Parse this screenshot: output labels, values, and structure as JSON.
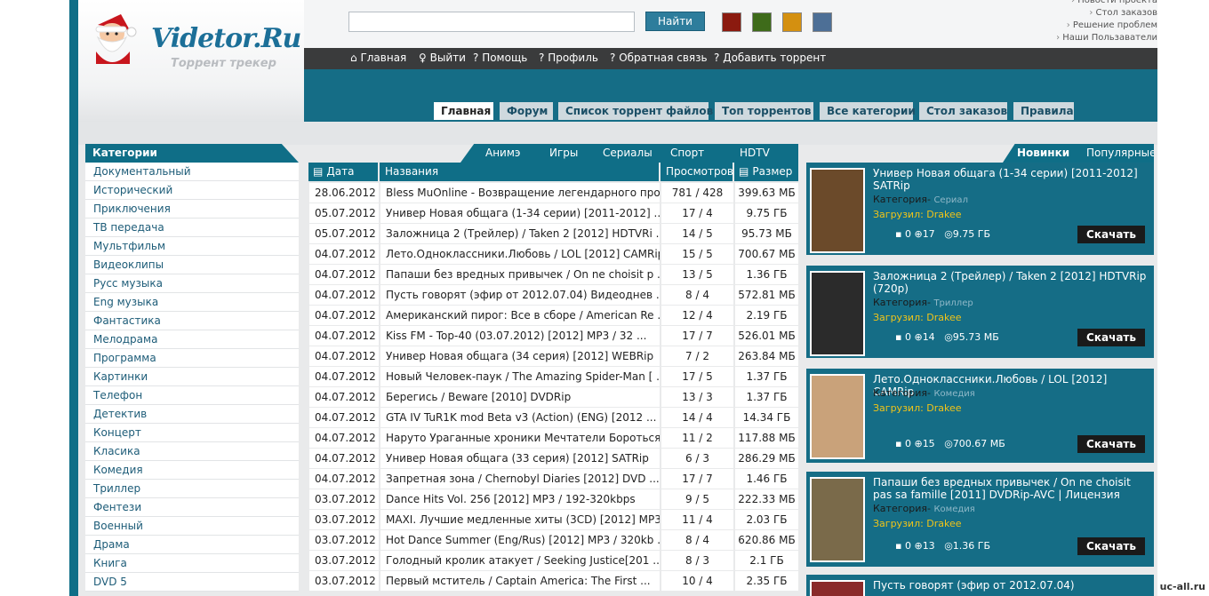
{
  "logo": {
    "title": "Videtor.Ru",
    "subtitle": "Торрент трекер"
  },
  "search": {
    "placeholder": "",
    "value": "",
    "button": "Найти"
  },
  "swatches": [
    "#8b1a0f",
    "#3e6b1a",
    "#d49010",
    "#4d6f96"
  ],
  "right_links": [
    "Новости проекта",
    "Стол заказов",
    "Решение проблем",
    "Наши Пользаватели"
  ],
  "nav": [
    {
      "icon": "home-icon",
      "label": "Главная"
    },
    {
      "icon": "key-icon",
      "label": "Выйти"
    },
    {
      "icon": "question-icon",
      "label": "Помощь"
    },
    {
      "icon": "question-icon",
      "label": "Профиль"
    },
    {
      "icon": "question-icon",
      "label": "Обратная связь"
    },
    {
      "icon": "question-icon",
      "label": "Добавить торрент"
    }
  ],
  "tabs": [
    "Главная",
    "Форум",
    "Список торрент файлов",
    "Топ торрентов",
    "Все категории",
    "Стол заказов",
    "Правила"
  ],
  "categories": {
    "title": "Категории",
    "items": [
      "Документальный",
      "Исторический",
      "Приключения",
      "ТВ передача",
      "Мультфильм",
      "Видеоклипы",
      "Русс музыка",
      "Eng музыка",
      "Фантастика",
      "Мелодрама",
      "Программа",
      "Картинки",
      "Телефон",
      "Детектив",
      "Концерт",
      "Класика",
      "Комедия",
      "Триллер",
      "Фентези",
      "Военный",
      "Драма",
      "Книга",
      "DVD 5"
    ]
  },
  "genres": [
    "Анимэ",
    "Игры",
    "Сериалы",
    "Спорт",
    "HDTV"
  ],
  "table": {
    "headers": {
      "date": "Дата",
      "name": "Названия",
      "views": "Просмотров",
      "size": "Размер"
    },
    "rows": [
      {
        "date": "28.06.2012",
        "name": "Bless MuOnline - Возвращение легендарного про ...",
        "views": "781 / 428",
        "size": "399.63 МБ"
      },
      {
        "date": "05.07.2012",
        "name": "Универ Новая общага (1-34 серии) [2011-2012] ...",
        "views": "17 / 4",
        "size": "9.75 ГБ"
      },
      {
        "date": "05.07.2012",
        "name": "Заложница 2 (Трейлер) / Taken 2 [2012] HDTVRi ...",
        "views": "14 / 5",
        "size": "95.73 МБ"
      },
      {
        "date": "04.07.2012",
        "name": "Лето.Одноклассники.Любовь / LOL [2012] CAMRip",
        "views": "15 / 5",
        "size": "700.67 МБ"
      },
      {
        "date": "04.07.2012",
        "name": "Папаши без вредных привычек / On ne choisit p ...",
        "views": "13 / 5",
        "size": "1.36 ГБ"
      },
      {
        "date": "04.07.2012",
        "name": "Пусть говорят (эфир от 2012.07.04) Видеоднев ...",
        "views": "8 / 4",
        "size": "572.81 МБ"
      },
      {
        "date": "04.07.2012",
        "name": "Американский пирог: Все в сборе / American Re ...",
        "views": "12 / 4",
        "size": "2.19 ГБ"
      },
      {
        "date": "04.07.2012",
        "name": "Kiss FM - Top-40 (03.07.2012) [2012] MP3 / 32 ...",
        "views": "17 / 7",
        "size": "526.01 МБ"
      },
      {
        "date": "04.07.2012",
        "name": "Универ Новая общага (34 серия) [2012] WEBRip",
        "views": "7 / 2",
        "size": "263.84 МБ"
      },
      {
        "date": "04.07.2012",
        "name": "Новый Человек-паук / The Amazing Spider-Man [ ...",
        "views": "17 / 5",
        "size": "1.37 ГБ"
      },
      {
        "date": "04.07.2012",
        "name": "Берегись / Beware [2010] DVDRip",
        "views": "13 / 3",
        "size": "1.37 ГБ"
      },
      {
        "date": "04.07.2012",
        "name": "GTA IV TuR1K mod Beta v3 (Action) (ENG) [2012 ...",
        "views": "14 / 4",
        "size": "14.34 ГБ"
      },
      {
        "date": "04.07.2012",
        "name": "Наруто Ураганные хроники Мечтатели Бороться / ...",
        "views": "11 / 2",
        "size": "117.88 МБ"
      },
      {
        "date": "04.07.2012",
        "name": "Универ Новая общага (33 серия) [2012] SATRip",
        "views": "6 / 3",
        "size": "286.29 МБ"
      },
      {
        "date": "04.07.2012",
        "name": "Запретная зона / Chernobyl Diaries [2012] DVD ...",
        "views": "17 / 7",
        "size": "1.46 ГБ"
      },
      {
        "date": "03.07.2012",
        "name": "Dance Hits Vol. 256 [2012] MP3 / 192-320kbps",
        "views": "9 / 5",
        "size": "222.33 МБ"
      },
      {
        "date": "03.07.2012",
        "name": "MAXI. Лучшие медленные хиты (3CD) [2012] MP3 ...",
        "views": "11 / 4",
        "size": "2.03 ГБ"
      },
      {
        "date": "03.07.2012",
        "name": "Hot Dance Summer (Eng/Rus) [2012] MP3 / 320kb ...",
        "views": "8 / 4",
        "size": "620.86 МБ"
      },
      {
        "date": "03.07.2012",
        "name": "Голодный кролик атакует / Seeking Justice[201 ...",
        "views": "8 / 3",
        "size": "2.1 ГБ"
      },
      {
        "date": "03.07.2012",
        "name": "Первый мститель / Captain America: The First ...",
        "views": "10 / 4",
        "size": "2.35 ГБ"
      }
    ]
  },
  "panel": {
    "tabs": [
      "Новинки",
      "Популярные"
    ],
    "download_label": "Скачать",
    "category_label": "Категория-",
    "uploaded_label": "Загрузил: Drakee",
    "cards": [
      {
        "title": "Универ Новая общага (1-34 серии) [2011-2012] SATRip",
        "category": "Сериал",
        "comments": "0",
        "views": "17",
        "size": "9.75 ГБ",
        "poster_color": "#6b4a2a"
      },
      {
        "title": "Заложница 2 (Трейлер) / Taken 2 [2012] HDTVRip (720p)",
        "category": "Триллер",
        "comments": "0",
        "views": "14",
        "size": "95.73 МБ",
        "poster_color": "#2b2b2b"
      },
      {
        "title": "Лето.Одноклассники.Любовь / LOL [2012] CAMRip",
        "category": "Комедия",
        "comments": "0",
        "views": "15",
        "size": "700.67 МБ",
        "poster_color": "#c9a27a"
      },
      {
        "title": "Папаши без вредных привычек / On ne choisit pas sa famille [2011] DVDRip-AVC | Лицензия",
        "category": "Комедия",
        "comments": "0",
        "views": "13",
        "size": "1.36 ГБ",
        "poster_color": "#7a6a4a"
      },
      {
        "title": "Пусть говорят (эфир от 2012.07.04)",
        "category": "",
        "comments": "",
        "views": "",
        "size": "",
        "poster_color": "#8a2a2a"
      }
    ]
  },
  "watermark": "uc-all.ru"
}
